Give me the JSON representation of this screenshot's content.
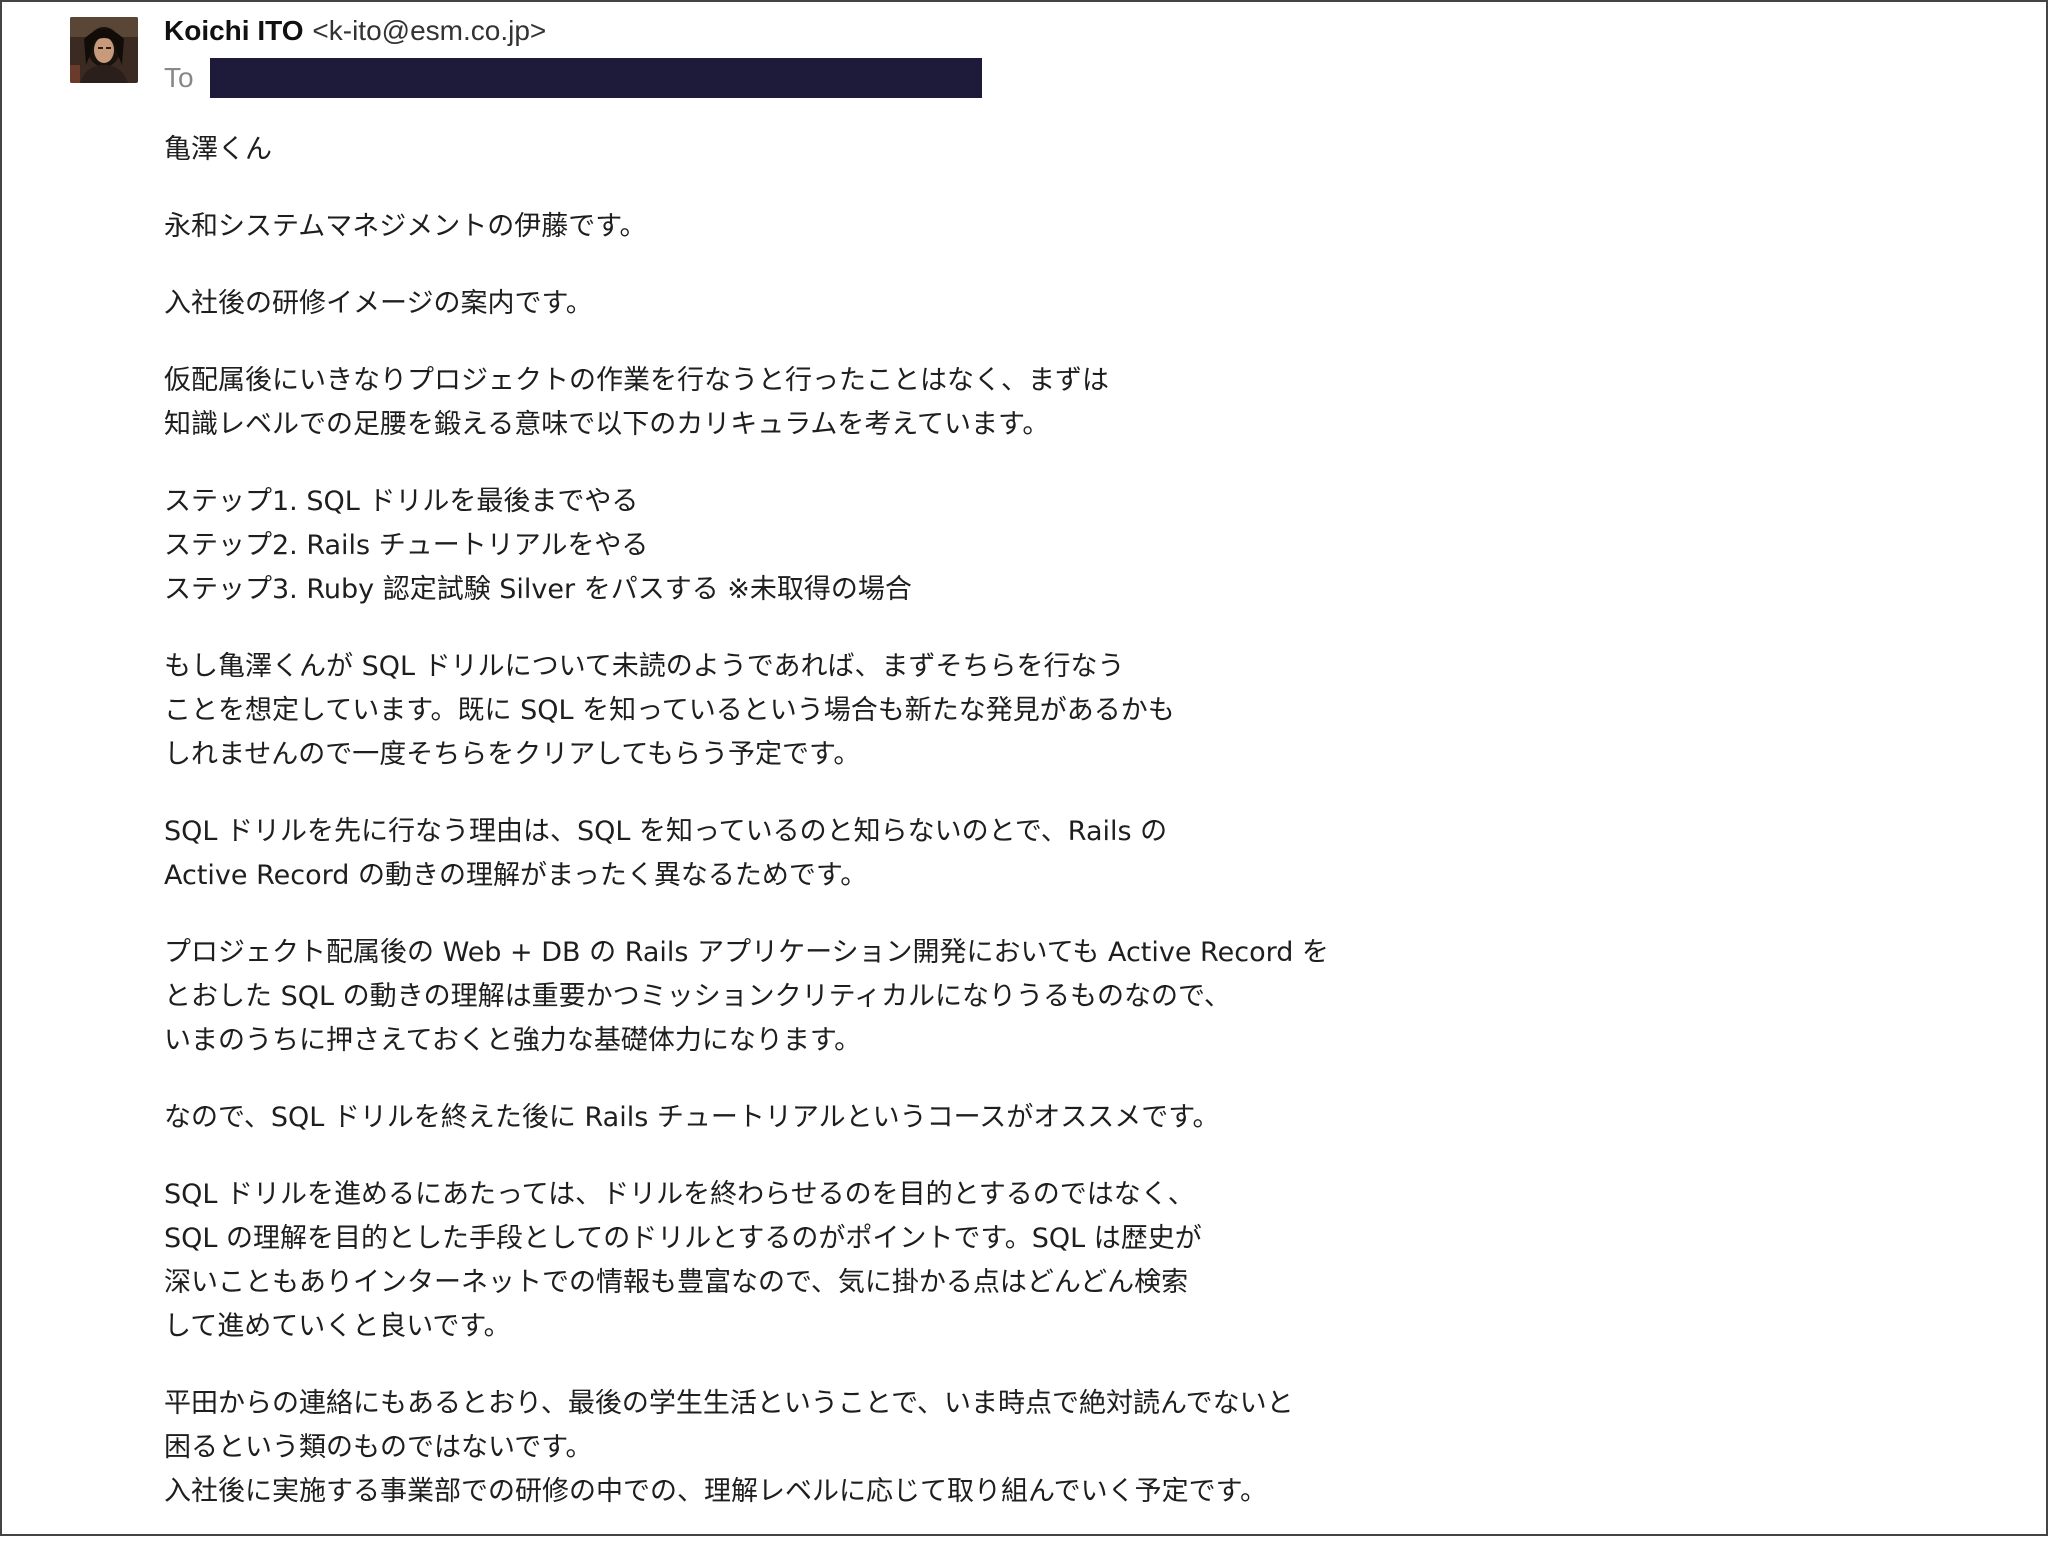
{
  "sender": {
    "name": "Koichi ITO",
    "email": "<k-ito@esm.co.jp>"
  },
  "recipient": {
    "label": "To",
    "value_redacted": true
  },
  "colors": {
    "redaction": "#1e1a3a",
    "text": "#1e1e1e",
    "to_label": "#888888",
    "frame_border": "#444444"
  },
  "body": {
    "paragraphs": [
      {
        "lines": [
          "亀澤くん"
        ]
      },
      {
        "lines": [
          "永和システムマネジメントの伊藤です。"
        ]
      },
      {
        "lines": [
          "入社後の研修イメージの案内です。"
        ]
      },
      {
        "lines": [
          "仮配属後にいきなりプロジェクトの作業を行なうと行ったことはなく、まずは",
          "知識レベルでの足腰を鍛える意味で以下のカリキュラムを考えています。"
        ]
      },
      {
        "lines": [
          "ステップ1. SQL ドリルを最後までやる",
          "ステップ2. Rails チュートリアルをやる",
          "ステップ3. Ruby 認定試験 Silver をパスする ※未取得の場合"
        ]
      },
      {
        "lines": [
          "もし亀澤くんが SQL ドリルについて未読のようであれば、まずそちらを行なう",
          "ことを想定しています。既に SQL を知っているという場合も新たな発見があるかも",
          "しれませんので一度そちらをクリアしてもらう予定です。"
        ]
      },
      {
        "lines": [
          "SQL ドリルを先に行なう理由は、SQL を知っているのと知らないのとで、Rails の",
          "Active Record の動きの理解がまったく異なるためです。"
        ]
      },
      {
        "lines": [
          "プロジェクト配属後の Web + DB の Rails アプリケーション開発においても Active Record を",
          "とおした SQL の動きの理解は重要かつミッションクリティカルになりうるものなので、",
          "いまのうちに押さえておくと強力な基礎体力になります。"
        ]
      },
      {
        "lines": [
          "なので、SQL ドリルを終えた後に Rails チュートリアルというコースがオススメです。"
        ]
      },
      {
        "lines": [
          "SQL ドリルを進めるにあたっては、ドリルを終わらせるのを目的とするのではなく、",
          "SQL の理解を目的とした手段としてのドリルとするのがポイントです。SQL は歴史が",
          "深いこともありインターネットでの情報も豊富なので、気に掛かる点はどんどん検索",
          "して進めていくと良いです。"
        ]
      },
      {
        "lines": [
          "平田からの連絡にもあるとおり、最後の学生生活ということで、いま時点で絶対読んでないと",
          "困るという類のものではないです。",
          "入社後に実施する事業部での研修の中での、理解レベルに応じて取り組んでいく予定です。"
        ]
      }
    ]
  }
}
